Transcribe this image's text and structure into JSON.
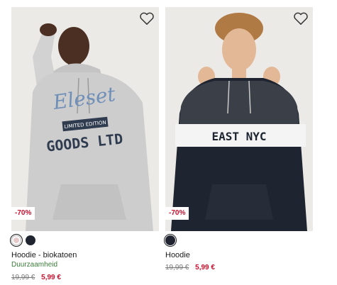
{
  "products": [
    {
      "discount": "-70%",
      "title": "Hoodie - biokatoen",
      "subtitle": "Duurzaamheid",
      "old_price": "19,99 €",
      "new_price": "5,99 €",
      "print_lines": [
        "Eleset",
        "LIMITED EDITION",
        "GOODS LTD"
      ],
      "swatches": [
        "#cfcfcf",
        "#1f2430"
      ],
      "selected_swatch": 0,
      "hoodie_color": "#cdcdcd"
    },
    {
      "discount": "-70%",
      "title": "Hoodie",
      "subtitle": "",
      "old_price": "19,99 €",
      "new_price": "5,99 €",
      "print_lines": [
        "EAST NYC"
      ],
      "swatches": [
        "#1f2430"
      ],
      "selected_swatch": 0,
      "hoodie_color": "#1e2430"
    }
  ],
  "icons": {
    "wishlist": "heart-outline-icon"
  },
  "colors": {
    "accent": "#c8102e",
    "sustainability": "#3a7d3a",
    "background": "#ffffff"
  }
}
